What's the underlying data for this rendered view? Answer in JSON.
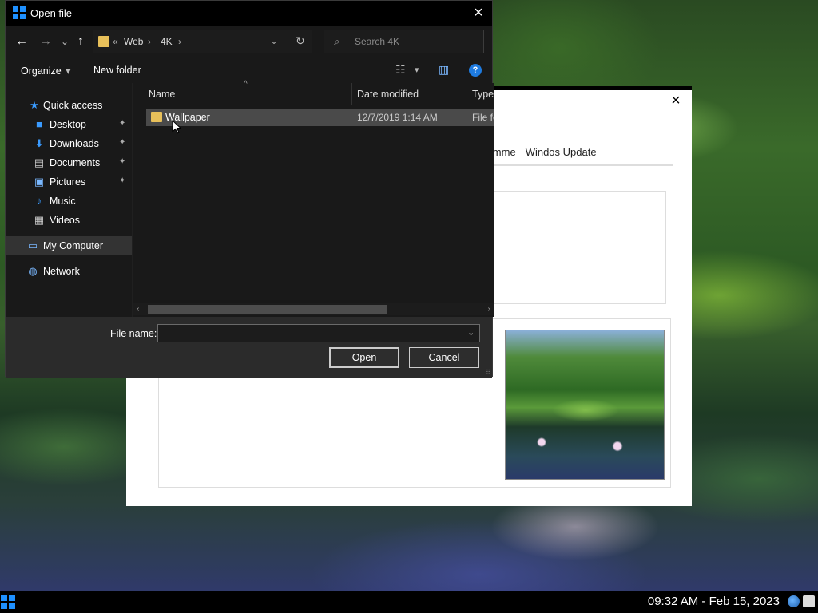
{
  "dialog": {
    "title": "Open file",
    "close_icon": "×"
  },
  "nav": {
    "back": "←",
    "forward": "→",
    "recent": "⌄",
    "up": "↑",
    "breadcrumb_overflow": "«",
    "path": [
      "Web",
      "4K"
    ],
    "separator": "›",
    "dropdown": "⌄",
    "refresh": "↻",
    "search_placeholder": "Search 4K",
    "search_icon": "⌕"
  },
  "toolbar": {
    "organize": "Organize",
    "organize_arrow": "▾",
    "new_folder": "New folder",
    "view_icon": "☷",
    "view_arrow": "▾",
    "pane_icon": "▥",
    "help": "?"
  },
  "sidebar": {
    "items": [
      {
        "label": "Quick access",
        "icon": "★"
      },
      {
        "label": "Desktop",
        "icon": "■",
        "pinned": "📌"
      },
      {
        "label": "Downloads",
        "icon": "⬇",
        "pinned": "📌"
      },
      {
        "label": "Documents",
        "icon": "▤",
        "pinned": "📌"
      },
      {
        "label": "Pictures",
        "icon": "▣",
        "pinned": "📌"
      },
      {
        "label": "Music",
        "icon": "♪"
      },
      {
        "label": "Videos",
        "icon": "▦"
      },
      {
        "label": "My Computer",
        "icon": "▭"
      },
      {
        "label": "Network",
        "icon": "◍"
      }
    ]
  },
  "filelist": {
    "columns": {
      "name": "Name",
      "date": "Date modified",
      "type": "Type"
    },
    "sort_arrow": "^",
    "rows": [
      {
        "name": "Wallpaper",
        "date": "12/7/2019 1:14 AM",
        "type": "File folder"
      }
    ],
    "scroll_left": "‹",
    "scroll_right": "›"
  },
  "bottom": {
    "file_name_label": "File name:",
    "file_name_value": "",
    "dropdown": "⌄",
    "open": "Open",
    "cancel": "Cancel"
  },
  "background_window": {
    "close": "×",
    "tabs": [
      "gramme",
      "Windos Update"
    ]
  },
  "taskbar": {
    "clock": "09:32 AM - Feb 15, 2023"
  },
  "colors": {
    "accent": "#1e90ff",
    "folder": "#e8c05a",
    "dialog_bg": "#202020"
  }
}
